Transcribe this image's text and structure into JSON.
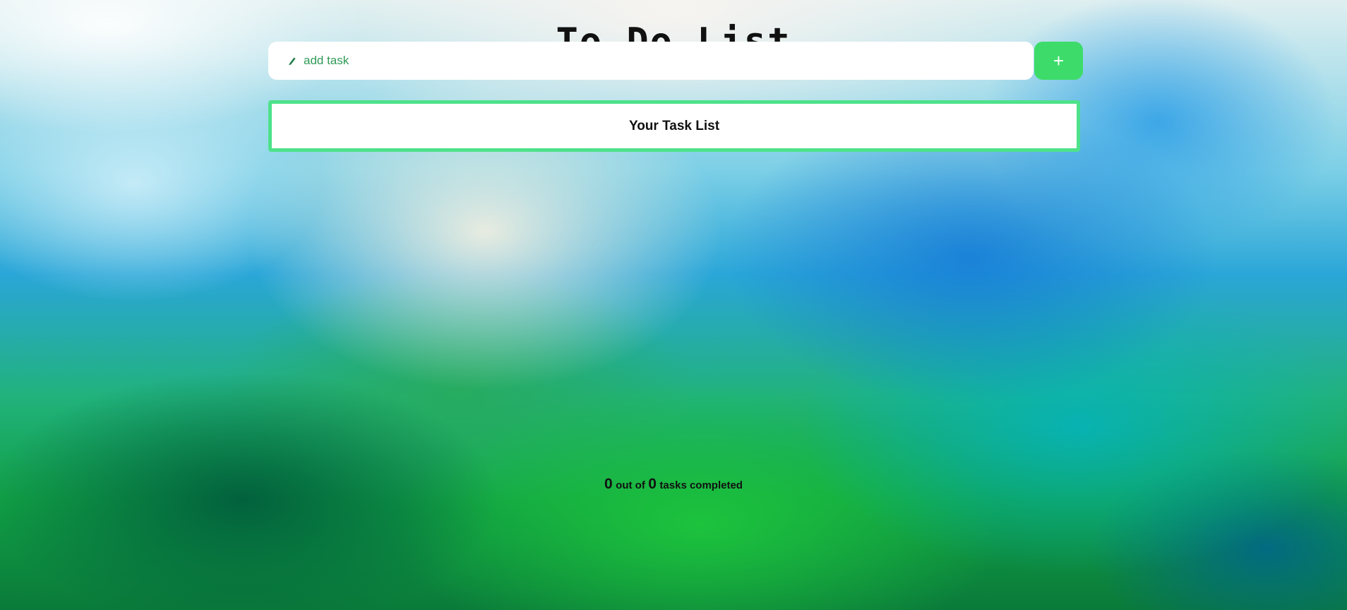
{
  "app": {
    "title": "To Do List"
  },
  "input": {
    "placeholder": "add task",
    "icon": "pencil-icon"
  },
  "add_button": {
    "label": "+"
  },
  "task_list": {
    "title": "Your Task List",
    "items": []
  },
  "counter": {
    "completed": "0",
    "out_of_label": "out of",
    "total": "0",
    "suffix_label": "tasks completed"
  },
  "colors": {
    "accent_green": "#3ddc6a",
    "border_green": "#4ee28a",
    "placeholder_green": "#2f9a56"
  }
}
